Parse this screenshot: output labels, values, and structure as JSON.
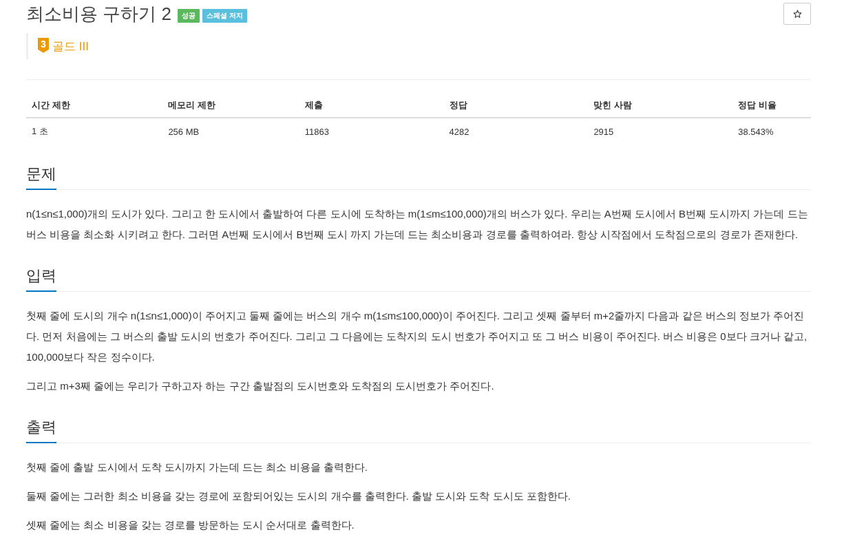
{
  "problem": {
    "title": "최소비용 구하기 2",
    "labels": [
      {
        "text": "성공",
        "color": "#5cb85c"
      },
      {
        "text": "스페셜 저지",
        "color": "#5bc0de"
      }
    ]
  },
  "tier": {
    "number": "3",
    "name": "골드 III"
  },
  "stats": {
    "columns": [
      "시간 제한",
      "메모리 제한",
      "제출",
      "정답",
      "맞힌 사람",
      "정답 비율"
    ],
    "rows": [
      [
        "1 초",
        "256 MB",
        "11863",
        "4282",
        "2915",
        "38.543%"
      ]
    ]
  },
  "sections": [
    {
      "heading": "문제",
      "paragraphs": [
        "n(1≤n≤1,000)개의 도시가 있다. 그리고 한 도시에서 출발하여 다른 도시에 도착하는 m(1≤m≤100,000)개의 버스가 있다. 우리는 A번째 도시에서 B번째 도시까지 가는데 드는 버스 비용을 최소화 시키려고 한다. 그러면 A번째 도시에서 B번째 도시 까지 가는데 드는 최소비용과 경로를 출력하여라. 항상 시작점에서 도착점으로의 경로가 존재한다."
      ]
    },
    {
      "heading": "입력",
      "paragraphs": [
        "첫째 줄에 도시의 개수 n(1≤n≤1,000)이 주어지고 둘째 줄에는 버스의 개수 m(1≤m≤100,000)이 주어진다. 그리고 셋째 줄부터 m+2줄까지 다음과 같은 버스의 정보가 주어진다. 먼저 처음에는 그 버스의 출발 도시의 번호가 주어진다. 그리고 그 다음에는 도착지의 도시 번호가 주어지고 또 그 버스 비용이 주어진다. 버스 비용은 0보다 크거나 같고, 100,000보다 작은 정수이다.",
        "그리고 m+3째 줄에는 우리가 구하고자 하는 구간 출발점의 도시번호와 도착점의 도시번호가 주어진다."
      ]
    },
    {
      "heading": "출력",
      "paragraphs": [
        "첫째 줄에 출발 도시에서 도착 도시까지 가는데 드는 최소 비용을 출력한다.",
        "둘째 줄에는 그러한 최소 비용을 갖는 경로에 포함되어있는 도시의 개수를 출력한다. 출발 도시와 도착 도시도 포함한다.",
        "셋째 줄에는 최소 비용을 갖는 경로를 방문하는 도시 순서대로 출력한다."
      ]
    }
  ]
}
